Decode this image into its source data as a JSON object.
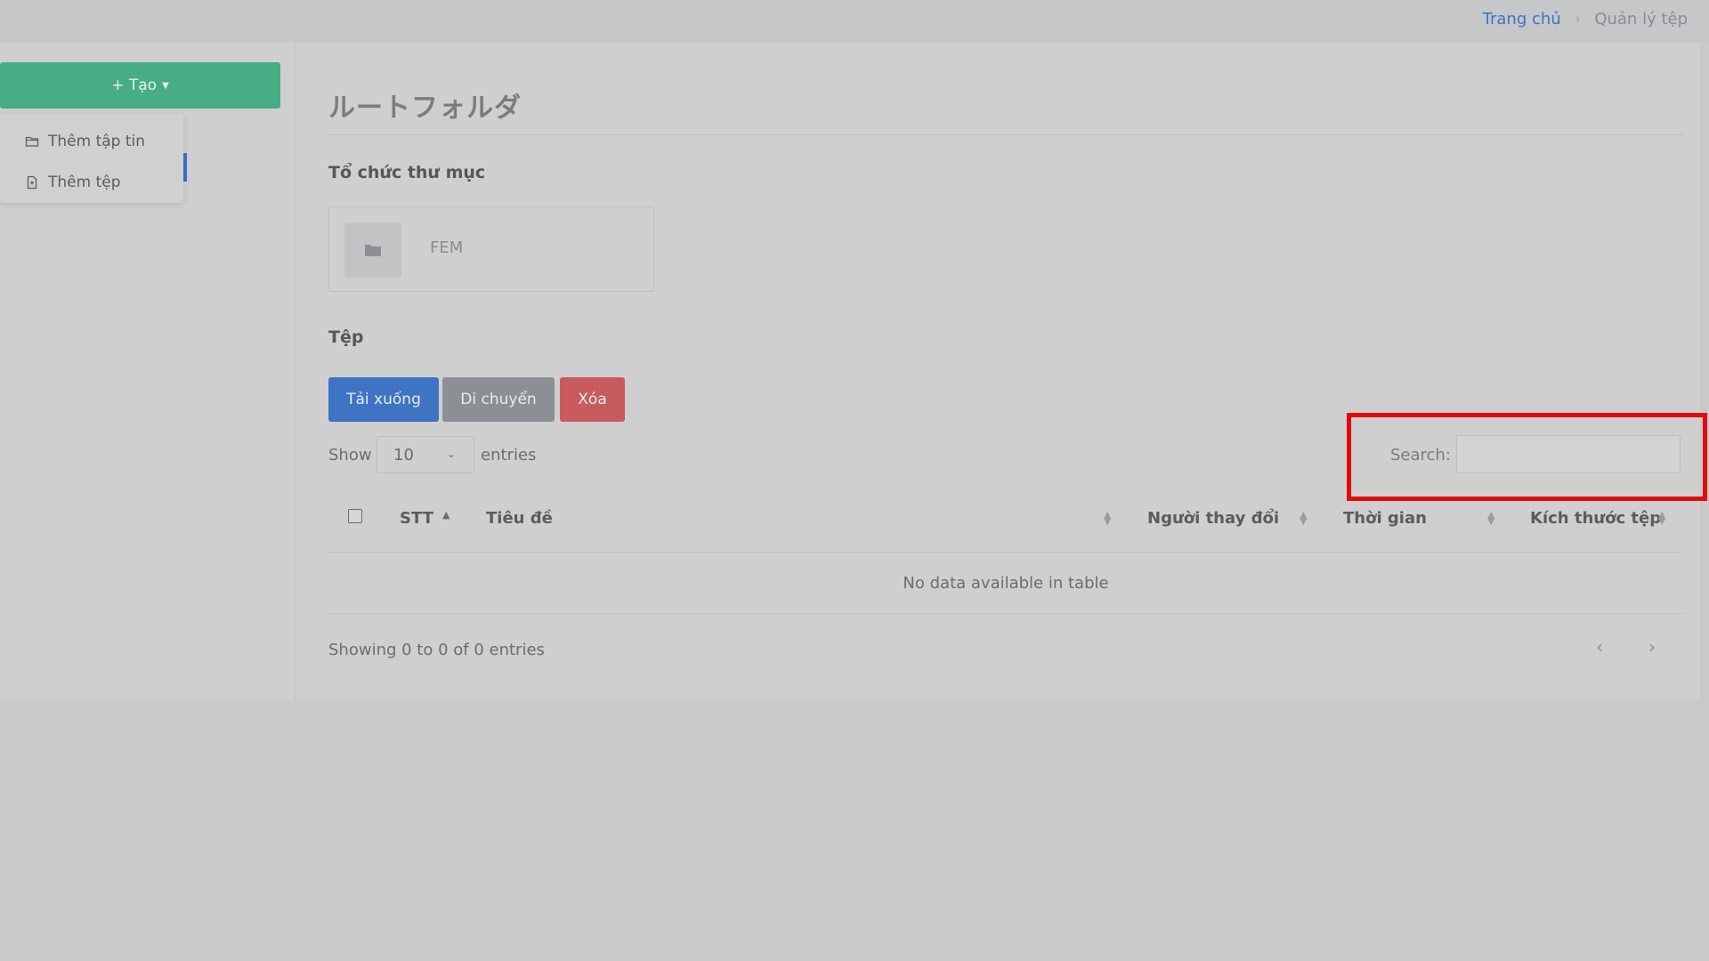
{
  "breadcrumb": {
    "home": "Trang chủ",
    "separator": "›",
    "current": "Quản lý tệp"
  },
  "sidebar": {
    "create_button": "+ Tạo",
    "dropdown": [
      {
        "label": "Thêm tập tin",
        "icon": "folder-icon"
      },
      {
        "label": "Thêm tệp",
        "icon": "file-icon"
      }
    ]
  },
  "main": {
    "title": "ルートフォルダ",
    "folders_heading": "Tổ chức thư mục",
    "folders": [
      {
        "name": "FEM",
        "icon": "folder-icon"
      }
    ],
    "files_heading": "Tệp",
    "actions": {
      "download": "Tải xuống",
      "move": "Di chuyển",
      "delete": "Xóa"
    },
    "table_controls": {
      "show_label": "Show",
      "page_size": "10",
      "entries_label": "entries",
      "search_label": "Search:",
      "search_value": ""
    },
    "table": {
      "columns": [
        "STT",
        "Tiêu đề",
        "Người thay đổi",
        "Thời gian",
        "Kích thước tệp"
      ],
      "empty_message": "No data available in table",
      "info": "Showing 0 to 0 of 0 entries",
      "pager_prev": "‹",
      "pager_next": "›"
    }
  },
  "colors": {
    "accent_blue": "#3e74c3",
    "create_green": "#46ad85",
    "delete_red": "#c95b5e",
    "highlight_red": "#e10b0b"
  }
}
